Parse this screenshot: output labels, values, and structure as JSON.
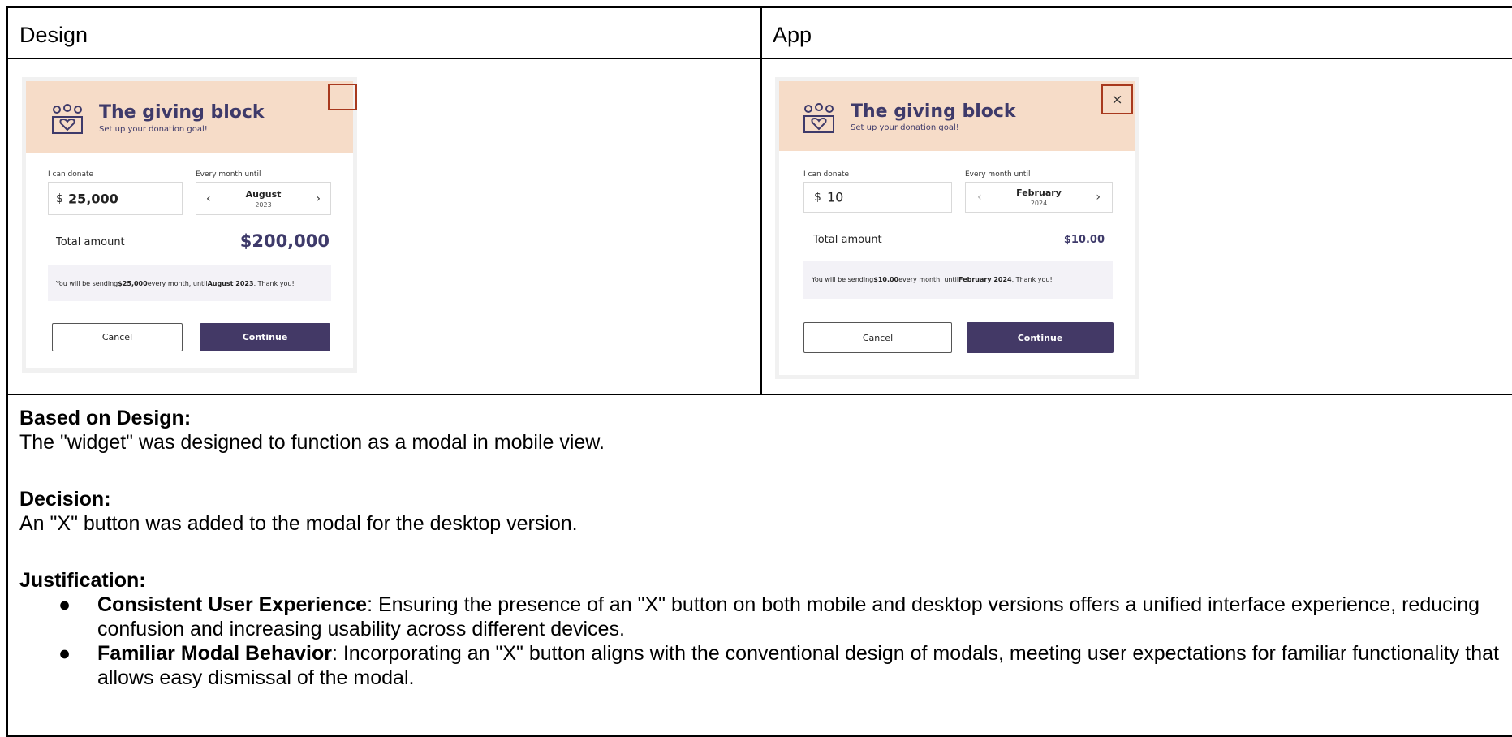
{
  "table": {
    "col_design": "Design",
    "col_app": "App"
  },
  "design_widget": {
    "title": "The giving block",
    "subtitle": "Set up your donation goal!",
    "donate_label": "I can donate",
    "currency": "$",
    "amount": "25,000",
    "until_label": "Every month until",
    "month": "August",
    "year": "2023",
    "total_label": "Total amount",
    "total_value": "$200,000",
    "msg_prefix": "You will be sending ",
    "msg_amount": "$25,000",
    "msg_mid": " every month, until ",
    "msg_date": "August 2023",
    "msg_suffix": ". Thank you!",
    "cancel": "Cancel",
    "continue": "Continue",
    "close_symbol": ""
  },
  "app_widget": {
    "title": "The giving block",
    "subtitle": "Set up your donation goal!",
    "donate_label": "I can donate",
    "currency": "$",
    "amount": "10",
    "until_label": "Every month until",
    "month": "February",
    "year": "2024",
    "total_label": "Total amount",
    "total_value": "$10.00",
    "msg_prefix": "You will be sending ",
    "msg_amount": "$10.00",
    "msg_mid": " every month, until ",
    "msg_date": "February 2024",
    "msg_suffix": ". Thank you!",
    "cancel": "Cancel",
    "continue": "Continue",
    "close_symbol": "×"
  },
  "notes": {
    "based_on_heading": "Based on Design:",
    "based_on_text": "The \"widget\" was designed to function as a modal in mobile view.",
    "decision_heading": "Decision:",
    "decision_text": "An \"X\" button was added to the modal for the desktop version.",
    "justification_heading": "Justification:",
    "bullets": [
      {
        "title": "Consistent User Experience",
        "text": ": Ensuring the presence of an \"X\" button on both mobile and desktop versions offers a unified interface experience, reducing confusion and increasing usability across different devices."
      },
      {
        "title": "Familiar Modal Behavior",
        "text": ": Incorporating an \"X\" button aligns with the conventional design of modals, meeting user expectations for familiar functionality that allows easy dismissal of the modal."
      }
    ]
  },
  "colors": {
    "header_bg": "#f6dcc8",
    "brand_purple": "#433966",
    "highlight_border": "#a8391e"
  }
}
